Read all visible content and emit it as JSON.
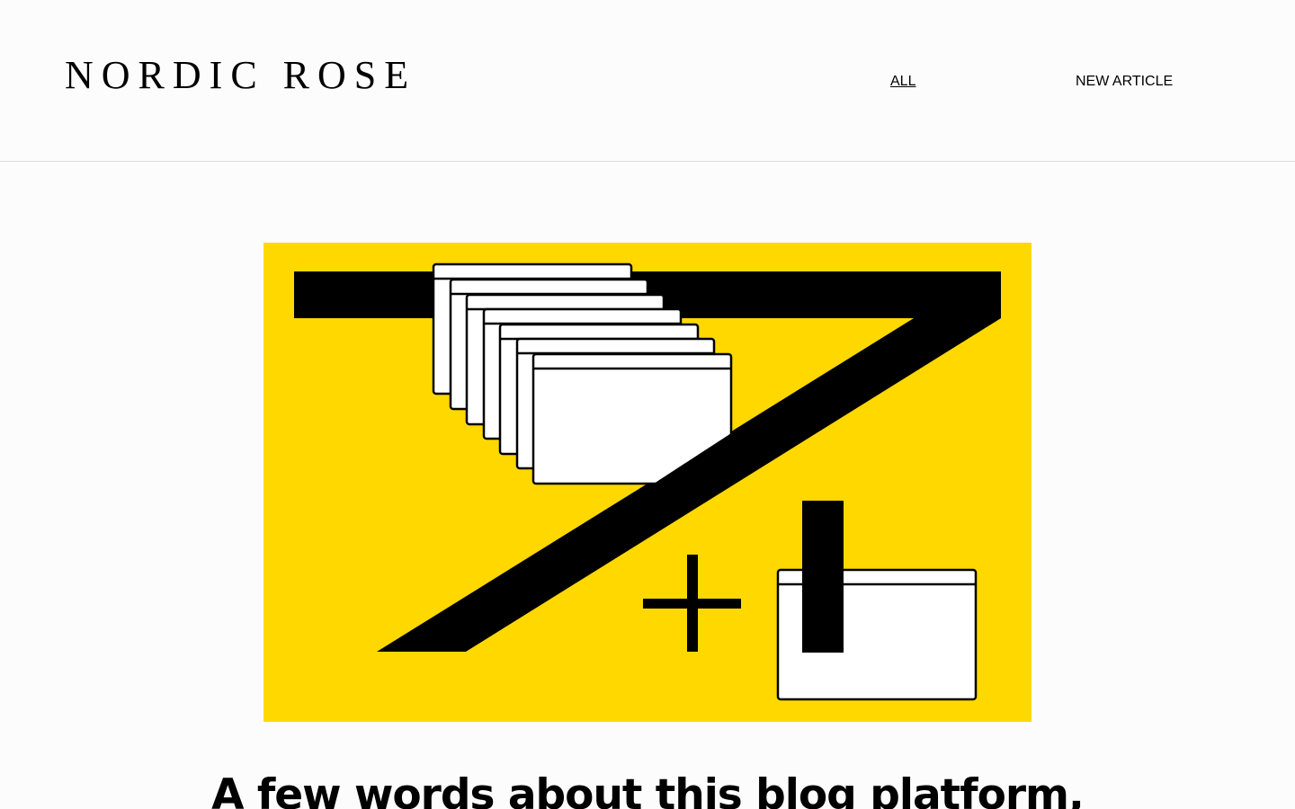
{
  "header": {
    "logo_text": "NORDIC ROSE",
    "nav": [
      {
        "label": "ALL",
        "active": true
      },
      {
        "label": "NEW ARTICLE",
        "active": false
      }
    ]
  },
  "hero": {
    "background_color": "#FFD800",
    "illustration_icon": "seven-plus-one-windows-illustration"
  },
  "article": {
    "title": "A few words about this blog platform,"
  }
}
